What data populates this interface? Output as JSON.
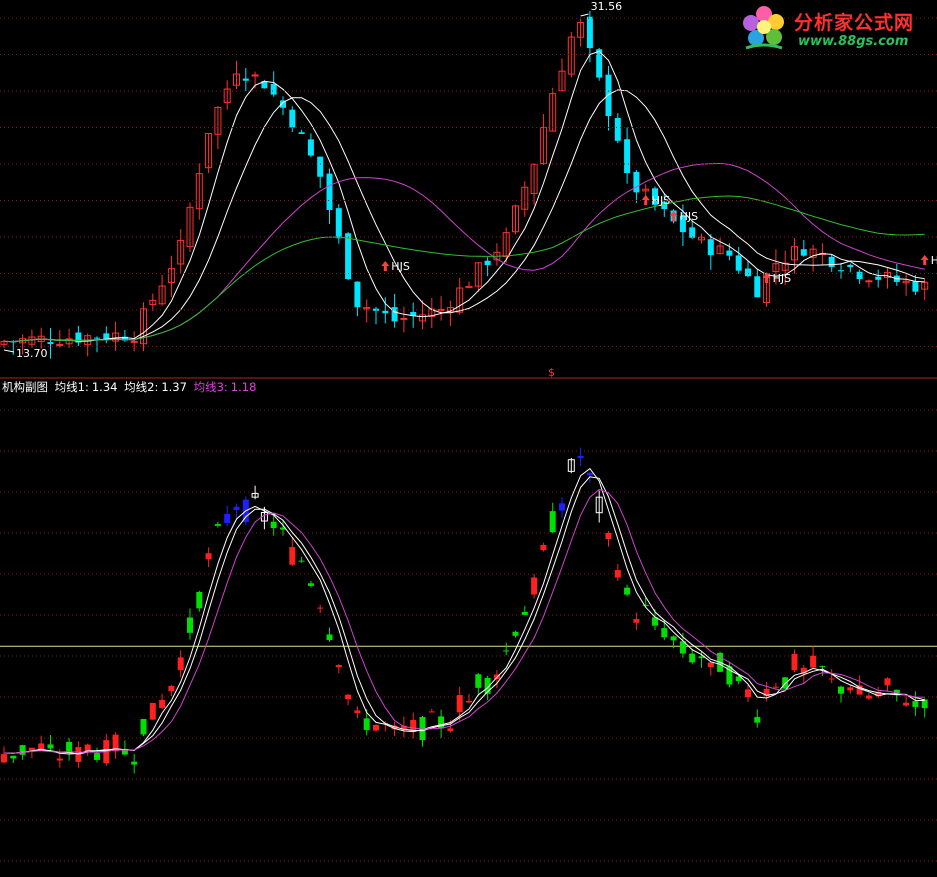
{
  "logo": {
    "title": "分析家公式网",
    "url": "www.88gs.com"
  },
  "top_panel": {
    "high_label": "31.56",
    "low_label": "13.70",
    "signal_label": "HJS",
    "separator_marker": "$"
  },
  "sub_panel": {
    "name": "机构副图",
    "ma1_label": "均线1:",
    "ma1_value": "1.34",
    "ma2_label": "均线2:",
    "ma2_value": "1.37",
    "ma3_label": "均线3:",
    "ma3_value": "1.18"
  },
  "colors": {
    "background": "#000000",
    "up": "#ff3030",
    "down": "#00e5ff",
    "ma_white": "#ffffff",
    "ma_magenta": "#cc44cc",
    "ma_green": "#33bb33",
    "grid": "#7a1a1a",
    "sub_up": "#ff2020",
    "sub_down": "#00e000",
    "sub_top_up": "#ffffff",
    "sub_top_down": "#2020ff",
    "zero_line": "#e0e080",
    "label_white": "#ffffff",
    "label_magenta": "#e040e0",
    "logo_red": "#ff3030",
    "logo_green": "#2ec05a"
  },
  "chart_data": [
    {
      "type": "candlestick",
      "panel": "price",
      "y_range": [
        13.2,
        32.2
      ],
      "high": 31.56,
      "low": 13.7,
      "signals": [
        "HJS",
        "HJS",
        "HJS",
        "HJS",
        "HJS"
      ],
      "series": [
        {
          "name": "MA short",
          "color": "white"
        },
        {
          "name": "MA medium",
          "color": "white"
        },
        {
          "name": "MA long",
          "color": "magenta"
        },
        {
          "name": "MA very long",
          "color": "green"
        }
      ]
    },
    {
      "type": "candlestick",
      "panel": "indicator",
      "title": "机构副图",
      "y_range": [
        -0.35,
        2.5
      ],
      "baseline": 1.0,
      "series": [
        {
          "name": "均线1",
          "value": 1.34
        },
        {
          "name": "均线2",
          "value": 1.37
        },
        {
          "name": "均线3",
          "value": 1.18
        }
      ]
    }
  ]
}
